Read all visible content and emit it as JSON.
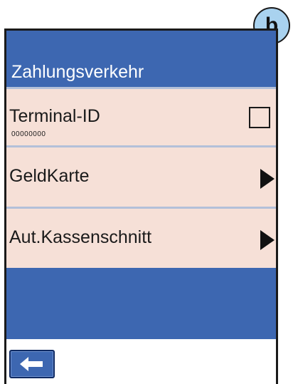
{
  "badge": {
    "label": "b"
  },
  "header": {
    "title": "Zahlungsverkehr"
  },
  "menu": {
    "items": [
      {
        "label": "Terminal-ID",
        "sub": "00000000",
        "control": "checkbox",
        "checked": false
      },
      {
        "label": "GeldKarte",
        "control": "arrow-right-icon"
      },
      {
        "label": "Aut.Kassenschnitt",
        "control": "arrow-right-icon"
      }
    ]
  },
  "footer": {
    "back_icon": "arrow-left-icon"
  },
  "colors": {
    "header_blue": "#3d67b1",
    "row_background": "#f6e0d7",
    "badge_blue": "#a9d2ef"
  }
}
